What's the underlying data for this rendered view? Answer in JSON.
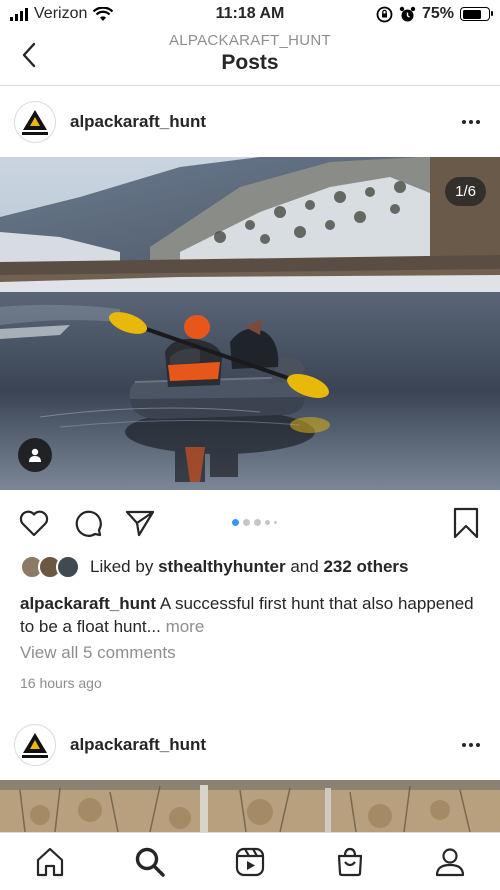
{
  "status_bar": {
    "carrier": "Verizon",
    "time": "11:18 AM",
    "battery": "75%",
    "battery_level": 0.75
  },
  "header": {
    "subtitle": "ALPACKARAFT_HUNT",
    "title": "Posts",
    "back_icon": "chevron-left-icon"
  },
  "post": {
    "username": "alpackaraft_hunt",
    "avatar_logo_text": "ALPACKA RAFT",
    "media_counter": "1/6",
    "carousel_total": 6,
    "carousel_active_index": 0,
    "likes": {
      "prefix": "Liked by",
      "user": "sthealthyhunter",
      "joiner": "and",
      "others": "232 others"
    },
    "caption": {
      "username": "alpackaraft_hunt",
      "text": "A successful first hunt that also happened to be a float hunt...",
      "more": "more"
    },
    "view_comments": "View all 5 comments",
    "time": "16 hours ago"
  },
  "next_post": {
    "username": "alpackaraft_hunt"
  },
  "tab_bar": {
    "items": [
      {
        "name": "home",
        "icon": "home-icon"
      },
      {
        "name": "search",
        "icon": "search-icon"
      },
      {
        "name": "reels",
        "icon": "reels-icon"
      },
      {
        "name": "shop",
        "icon": "shop-icon"
      },
      {
        "name": "profile",
        "icon": "profile-icon"
      }
    ]
  },
  "colors": {
    "accent": "#3897f0",
    "text": "#262626",
    "muted": "#8e8e8e",
    "divider": "#dbdbdb",
    "raft_orange": "#e8571a",
    "paddle_yellow": "#e8b90b"
  }
}
